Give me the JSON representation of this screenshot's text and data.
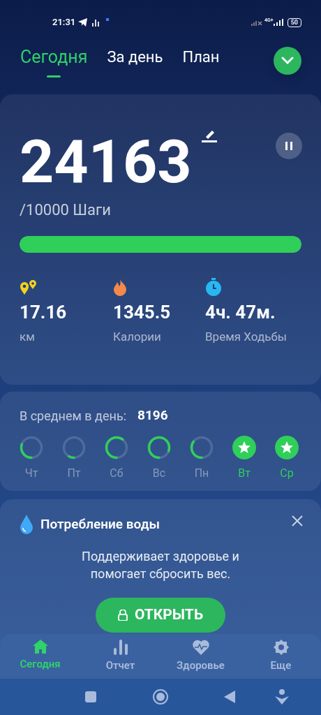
{
  "status_bar": {
    "time": "21:31",
    "network": "4G+",
    "battery": "50"
  },
  "tabs": [
    {
      "label": "Сегодня",
      "selected": true
    },
    {
      "label": "За день",
      "selected": false
    },
    {
      "label": "План",
      "selected": false
    }
  ],
  "steps": {
    "count": "24163",
    "goal": "/10000 Шаги",
    "level": 1
  },
  "stats": [
    {
      "kind": "distance",
      "value": "17.16",
      "label": "км"
    },
    {
      "kind": "calories",
      "value": "1345.5",
      "label": "Калории"
    },
    {
      "kind": "time",
      "value": "4ч. 47м.",
      "label": "Время Ходьбы"
    }
  ],
  "average": {
    "label": "В среднем в день:",
    "value": "8196"
  },
  "days": [
    {
      "label": "Чт",
      "achieved": false
    },
    {
      "label": "Пт",
      "achieved": false
    },
    {
      "label": "Сб",
      "achieved": false
    },
    {
      "label": "Вс",
      "achieved": false
    },
    {
      "label": "Пн",
      "achieved": false
    },
    {
      "label": "Вт",
      "achieved": true
    },
    {
      "label": "Ср",
      "achieved": true
    }
  ],
  "water_card": {
    "title": "Потребление воды",
    "text": "Поддерживает здоровье и помогает сбросить вес.",
    "button": "ОТКРЫТЬ"
  },
  "bottom_nav": [
    {
      "kind": "home",
      "label": "Сегодня",
      "selected": true
    },
    {
      "kind": "report",
      "label": "Отчет",
      "selected": false
    },
    {
      "kind": "health",
      "label": "Здоровье",
      "selected": false
    },
    {
      "kind": "more",
      "label": "Еще",
      "selected": false
    }
  ]
}
